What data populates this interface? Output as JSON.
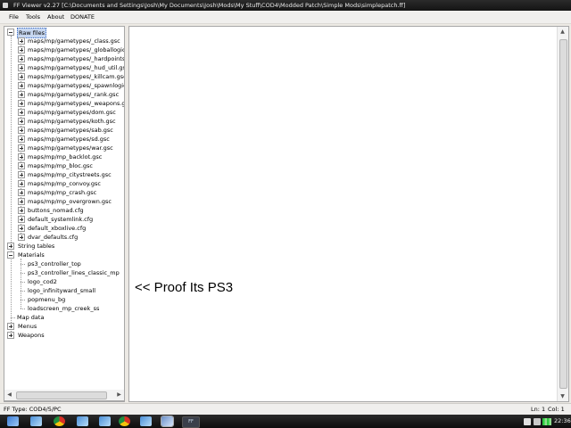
{
  "window": {
    "title": "FF Viewer v2.27 [C:\\Documents and Settings\\Josh\\My Documents\\Josh\\Mods\\My Stuff\\COD4\\Modded Patch\\Simple Mods\\simplepatch.ff]"
  },
  "menu": {
    "items": [
      "File",
      "Tools",
      "About",
      "DONATE"
    ]
  },
  "tree": {
    "raw_files_label": "Raw files",
    "raw_files": [
      "maps/mp/gametypes/_class.gsc",
      "maps/mp/gametypes/_globallogic.gs",
      "maps/mp/gametypes/_hardpoints.gs",
      "maps/mp/gametypes/_hud_util.gsc",
      "maps/mp/gametypes/_killcam.gsc",
      "maps/mp/gametypes/_spawnlogic.g",
      "maps/mp/gametypes/_rank.gsc",
      "maps/mp/gametypes/_weapons.gsc",
      "maps/mp/gametypes/dom.gsc",
      "maps/mp/gametypes/koth.gsc",
      "maps/mp/gametypes/sab.gsc",
      "maps/mp/gametypes/sd.gsc",
      "maps/mp/gametypes/war.gsc",
      "maps/mp/mp_backlot.gsc",
      "maps/mp/mp_bloc.gsc",
      "maps/mp/mp_citystreets.gsc",
      "maps/mp/mp_convoy.gsc",
      "maps/mp/mp_crash.gsc",
      "maps/mp/mp_overgrown.gsc",
      "buttons_nomad.cfg",
      "default_systemlink.cfg",
      "default_xboxlive.cfg",
      "dvar_defaults.cfg"
    ],
    "string_tables_label": "String tables",
    "materials_label": "Materials",
    "materials": [
      "ps3_controller_top",
      "ps3_controller_lines_classic_mp",
      "logo_cod2",
      "logo_infinityward_small",
      "popmenu_bg",
      "loadscreen_mp_creek_ss"
    ],
    "map_data_label": "Map data",
    "menus_label": "Menus",
    "weapons_label": "Weapons"
  },
  "content": {
    "proof_text": "<< Proof Its PS3"
  },
  "status": {
    "ff_type": "FF Type: COD4/5/PC",
    "line": "Ln: 1",
    "col": "Col: 1"
  },
  "taskbar": {
    "clock": "22:36",
    "active_app": "FF"
  }
}
